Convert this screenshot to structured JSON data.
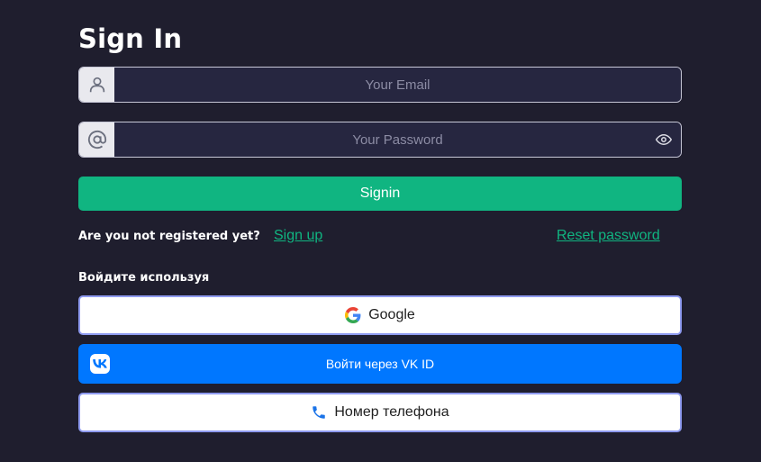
{
  "title": "Sign In",
  "email": {
    "placeholder": "Your Email",
    "icon": "user-icon"
  },
  "password": {
    "placeholder": "Your Password",
    "icon": "at-icon",
    "toggle_icon": "eye-icon"
  },
  "signin_label": "Signin",
  "register": {
    "question": "Are you not registered yet?",
    "signup_link": "Sign up",
    "reset_link": "Reset password"
  },
  "social_heading": "Войдите используя",
  "social": {
    "google_label": "Google",
    "vk_label": "Войти через VK ID",
    "phone_label": "Номер телефона"
  },
  "colors": {
    "background": "#1f1e2e",
    "accent": "#10b581",
    "vk": "#0077ff",
    "social_border": "#8f9bf0"
  }
}
